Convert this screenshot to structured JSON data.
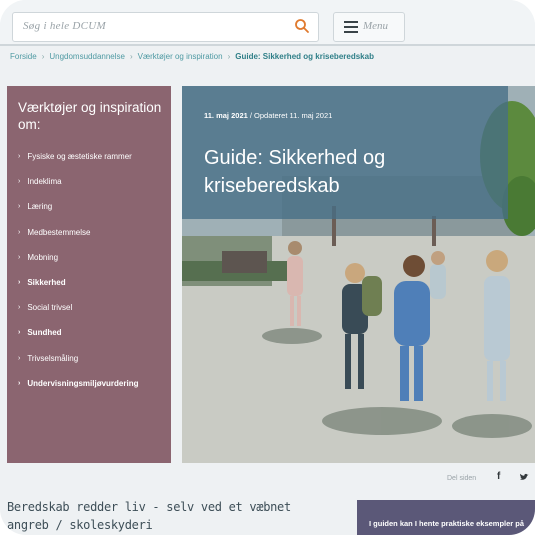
{
  "search": {
    "placeholder": "Søg i hele DCUM"
  },
  "menu": {
    "label": "Menu"
  },
  "breadcrumb": [
    {
      "label": "Forside"
    },
    {
      "label": "Ungdomsuddannelse"
    },
    {
      "label": "Værktøjer og inspiration"
    },
    {
      "label": "Guide: Sikkerhed og kriseberedskab"
    }
  ],
  "sidebar": {
    "title": "Værktøjer og inspiration om:",
    "items": [
      {
        "label": "Fysiske og æstetiske rammer",
        "bold": false
      },
      {
        "label": "Indeklima",
        "bold": false
      },
      {
        "label": "Læring",
        "bold": false
      },
      {
        "label": "Medbestemmelse",
        "bold": false
      },
      {
        "label": "Mobning",
        "bold": false
      },
      {
        "label": "Sikkerhed",
        "bold": true
      },
      {
        "label": "Social trivsel",
        "bold": false
      },
      {
        "label": "Sundhed",
        "bold": true
      },
      {
        "label": "Trivselsmåling",
        "bold": false
      },
      {
        "label": "Undervisningsmiljøvurdering",
        "bold": true
      }
    ]
  },
  "hero": {
    "date": "11. maj 2021",
    "updated": " / Opdateret 11. maj 2021",
    "title": "Guide: Sikkerhed og kriseberedskab"
  },
  "share": {
    "label": "Del siden"
  },
  "lead": "Beredskab redder liv - selv ved et væbnet angreb / skoleskyderi",
  "cta": {
    "text": "I guiden kan I hente praktiske eksempler på"
  },
  "colors": {
    "sidebar": "#8b6570",
    "hero_panel": "#466e87",
    "accent": "#e07a2e",
    "cta": "#5b5878"
  }
}
